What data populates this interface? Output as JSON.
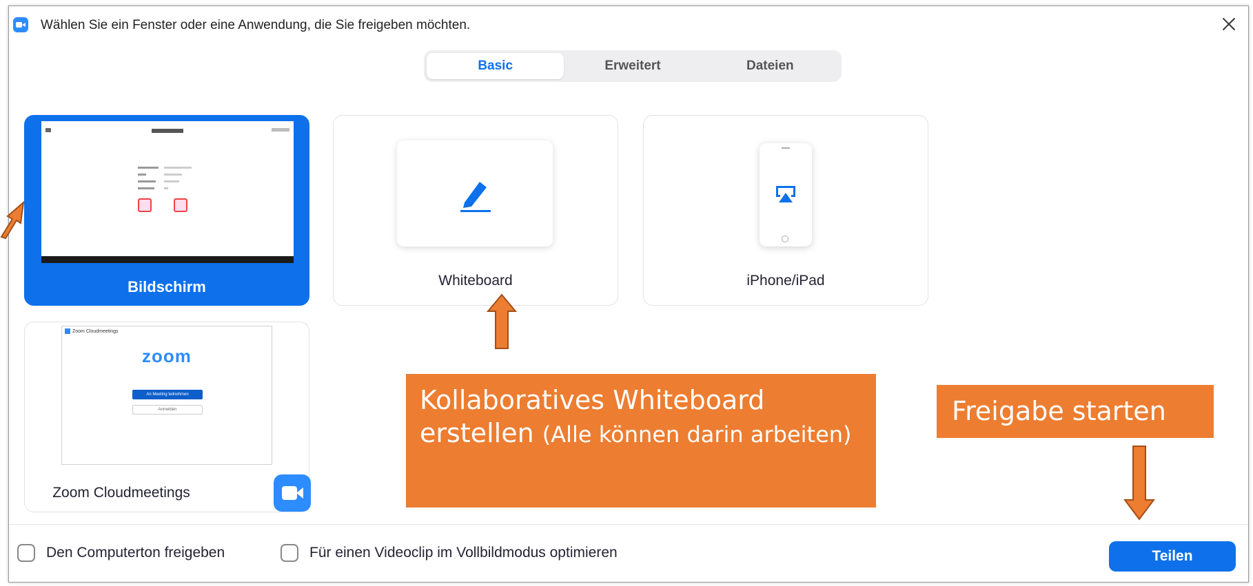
{
  "window": {
    "title": "Wählen Sie ein Fenster oder eine Anwendung, die Sie freigeben möchten."
  },
  "tabs": [
    {
      "label": "Basic",
      "active": true
    },
    {
      "label": "Erweitert",
      "active": false
    },
    {
      "label": "Dateien",
      "active": false
    }
  ],
  "tiles": {
    "screen": {
      "label": "Bildschirm",
      "selected": true
    },
    "whiteboard": {
      "label": "Whiteboard"
    },
    "ios": {
      "label": "iPhone/iPad"
    },
    "zoom": {
      "label": "Zoom Cloudmeetings",
      "preview_logo": "zoom",
      "preview_join": "An Meeting teilnehmen",
      "preview_signin": "Anmelden"
    }
  },
  "options": {
    "computer_sound": {
      "label": "Den Computerton freigeben",
      "checked": false
    },
    "video_clip": {
      "label": "Für einen Videoclip im Vollbildmodus optimieren",
      "checked": false
    }
  },
  "share_button": {
    "label": "Teilen"
  },
  "annotations": {
    "whiteboard_main": "Kollaboratives Whiteboard erstellen",
    "whiteboard_sub": "(Alle können darin arbeiten)",
    "share": "Freigabe starten"
  },
  "colors": {
    "accent": "#0e71eb",
    "zoom_blue": "#2d8cff",
    "callout": "#ed7d31"
  }
}
